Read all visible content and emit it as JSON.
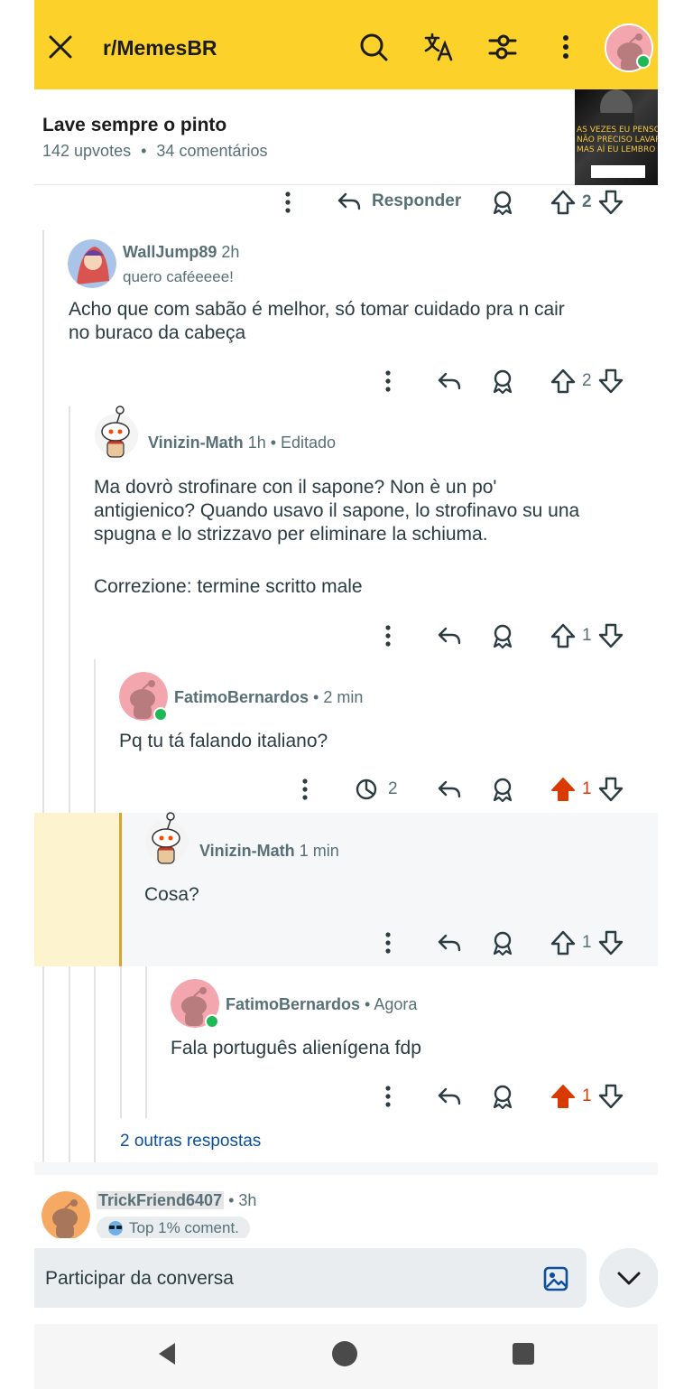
{
  "header": {
    "subreddit": "r/MemesBR",
    "icons": [
      "close-icon",
      "search-icon",
      "translate-icon",
      "filter-icon",
      "more-vertical-icon",
      "avatar"
    ]
  },
  "post": {
    "title": "Lave sempre o pinto",
    "upvotes": "142 upvotes",
    "separator": "•",
    "comments": "34 comentários",
    "thumb_text": "AS VEZES EU PENSO QUE\nNÃO PRECISO LAVAR O PI\nMAS AÍ EU LEMBRO QUE"
  },
  "top_actions": {
    "reply_label": "Responder",
    "votes": "2"
  },
  "comments": [
    {
      "author": "WallJump89",
      "time": "2h",
      "flair": "quero caféeeee!",
      "body_lines": [
        "Acho que com sabão é melhor, só tomar cuidado pra n cair",
        "no buraco da cabeça"
      ],
      "votes": "2"
    },
    {
      "author": "Vinizin-Math",
      "meta": "1h • Editado",
      "body_lines": [
        "Ma dovrò strofinare con il sapone? Non è un po'",
        "antigienico? Quando usavo il sapone, lo strofinavo su una",
        "spugna e lo strizzavo per eliminare la schiuma.",
        "",
        "Correzione: termine scritto male"
      ],
      "votes": "1"
    },
    {
      "author": "FatimoBernardos",
      "meta": "• 2 min",
      "body_lines": [
        "Pq tu tá falando italiano?"
      ],
      "timer_count": "2",
      "votes": "1"
    },
    {
      "author": "Vinizin-Math",
      "meta": "1 min",
      "body_lines": [
        "Cosa?"
      ],
      "votes": "1"
    },
    {
      "author": "FatimoBernardos",
      "meta": "• Agora",
      "body_lines": [
        "Fala português alienígena fdp"
      ],
      "votes": "1"
    }
  ],
  "more_replies": "2 outras respostas",
  "next_comment": {
    "author": "TrickFriend6407",
    "meta": "• 3h",
    "badge": "Top 1% coment."
  },
  "composer": {
    "placeholder": "Participar da conversa"
  },
  "colors": {
    "header_bg": "#fcd12a",
    "upvoted": "#d93a00",
    "link": "#0a4f9c",
    "highlight": "#fdf3cf",
    "highlight_bar": "#d4a72c"
  }
}
